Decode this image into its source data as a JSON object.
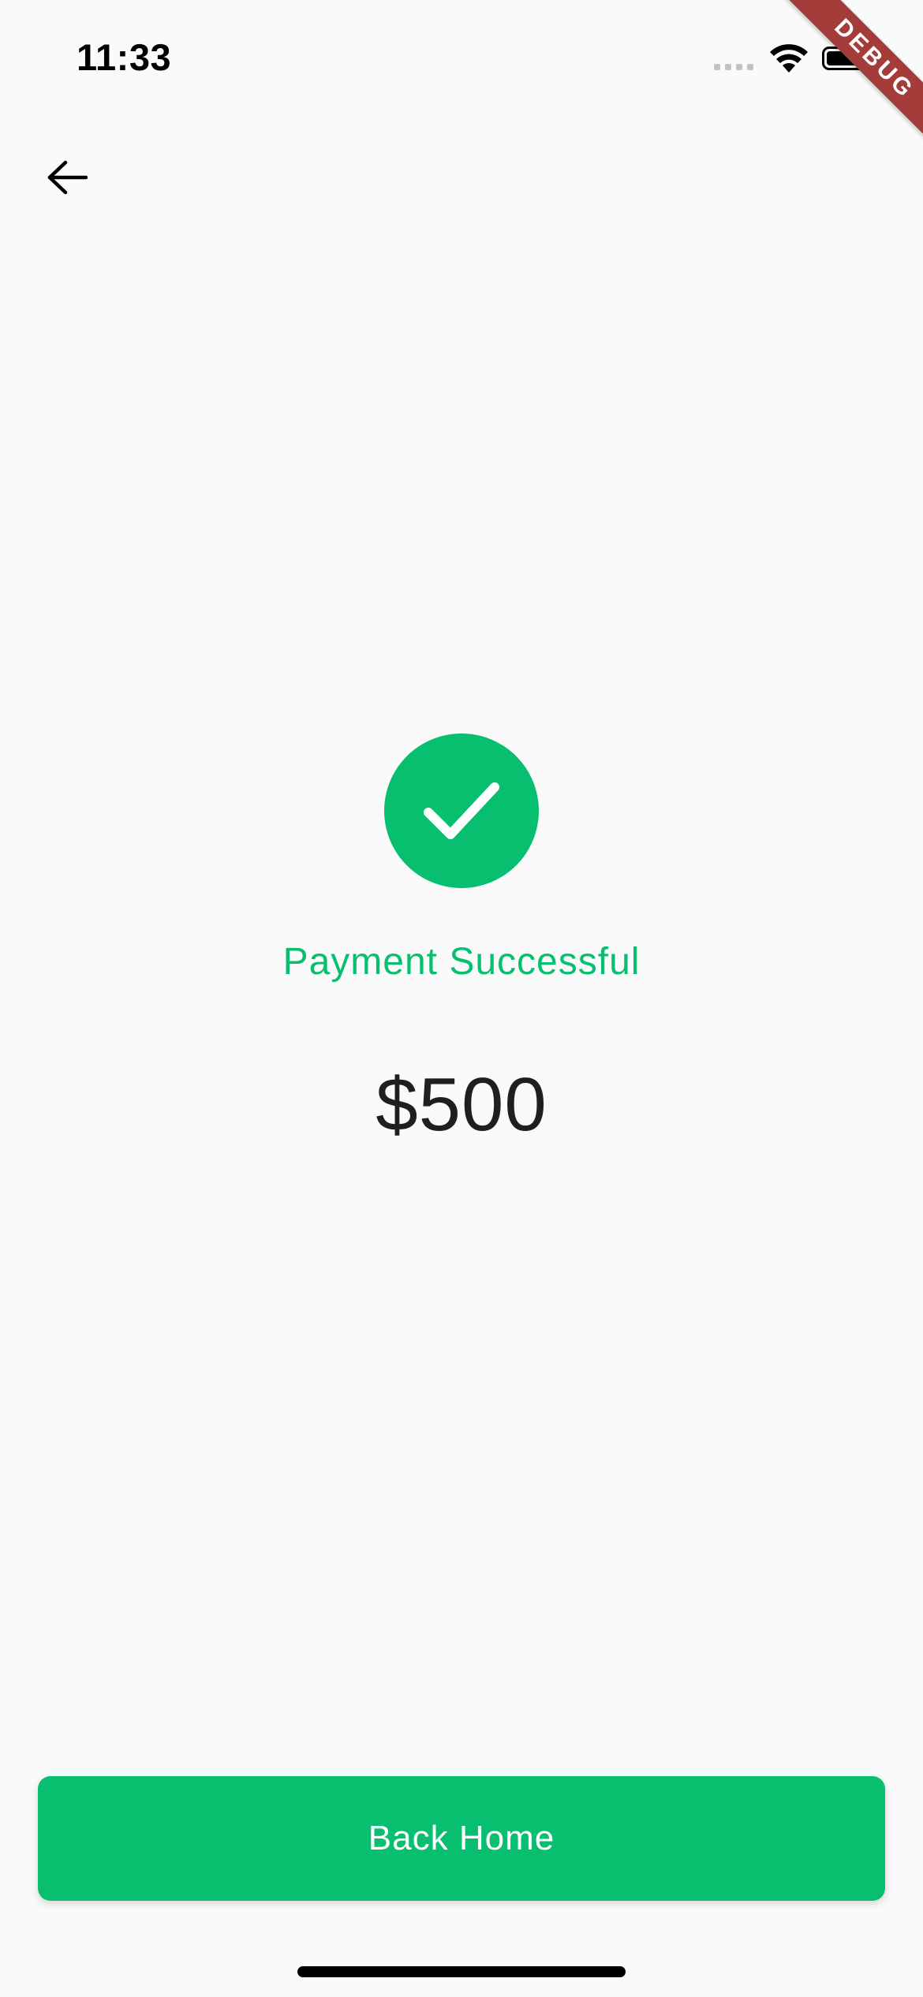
{
  "status_bar": {
    "time": "11:33"
  },
  "debug_banner": {
    "label": "DEBUG"
  },
  "success": {
    "message": "Payment Successful",
    "amount": "$500"
  },
  "actions": {
    "back_home_label": "Back Home"
  },
  "colors": {
    "accent": "#08bf6f",
    "background": "#fafafa",
    "amount_text": "#1f1f1f",
    "debug_banner": "#a43d3a"
  },
  "icons": {
    "back": "arrow-left-icon",
    "success": "checkmark-icon",
    "wifi": "wifi-icon",
    "battery": "battery-icon",
    "signal": "cellular-signal-icon"
  }
}
